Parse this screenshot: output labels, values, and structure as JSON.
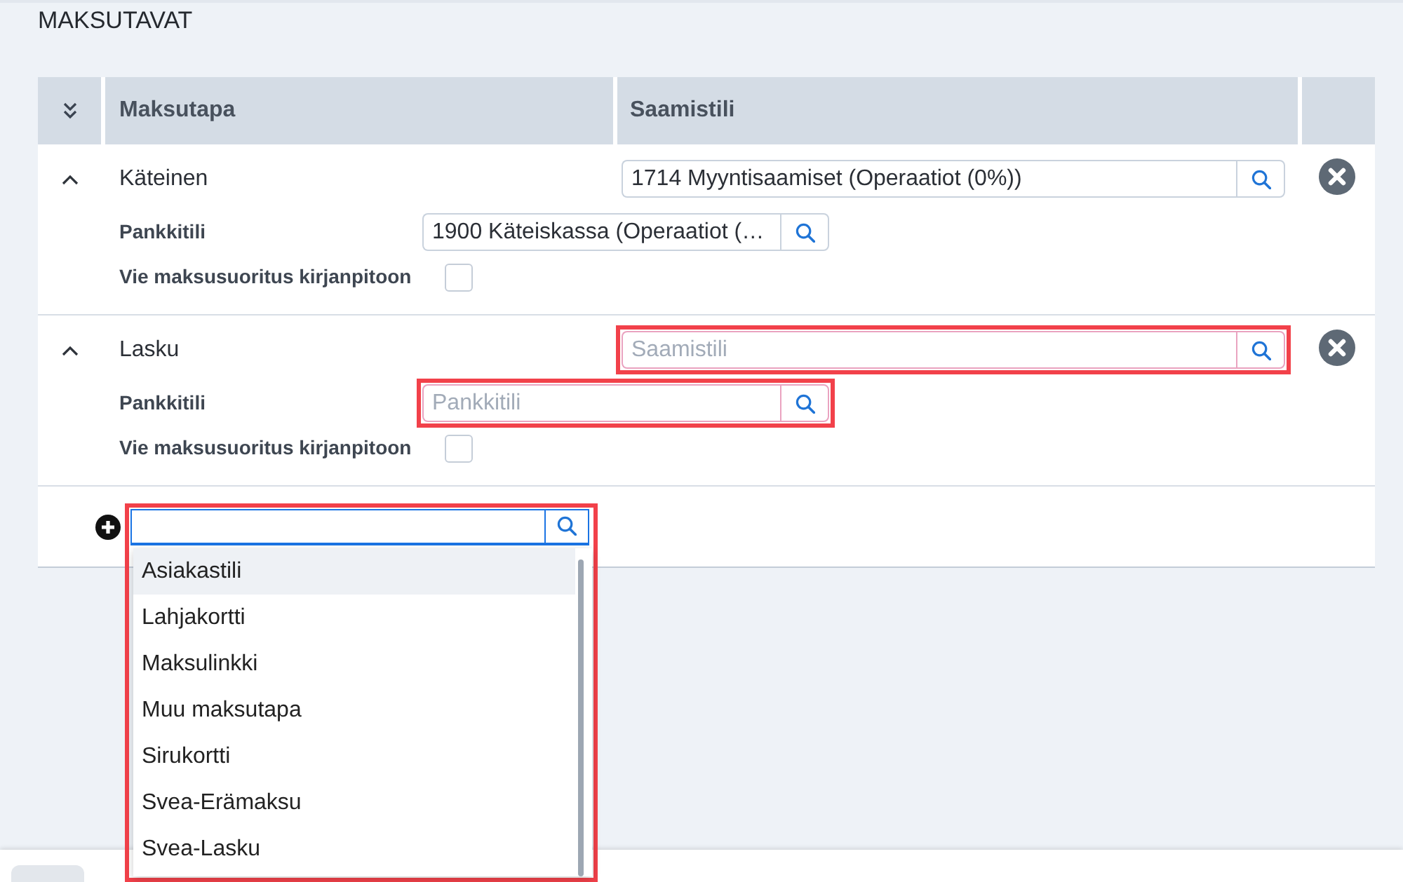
{
  "section_title": "MAKSUTAVAT",
  "table": {
    "columns": [
      "Maksutapa",
      "Saamistili"
    ],
    "rows": [
      {
        "name": "Käteinen",
        "expanded": true,
        "saamistili": {
          "value": "1714 Myyntisaamiset (Operaatiot (0%))",
          "invalid": false,
          "highlighted": false
        },
        "pankkitili_label": "Pankkitili",
        "pankkitili": {
          "value": "1900 Käteiskassa (Operaatiot (…",
          "invalid": false,
          "highlighted": false
        },
        "export_label": "Vie maksusuoritus kirjanpitoon",
        "export_checked": false
      },
      {
        "name": "Lasku",
        "expanded": true,
        "saamistili": {
          "placeholder": "Saamistili",
          "invalid": true,
          "highlighted": true
        },
        "pankkitili_label": "Pankkitili",
        "pankkitili": {
          "placeholder": "Pankkitili",
          "invalid": true,
          "highlighted": true
        },
        "export_label": "Vie maksusuoritus kirjanpitoon",
        "export_checked": false
      }
    ],
    "add_row": {
      "focused": true,
      "highlighted": true,
      "options": [
        {
          "label": "Asiakastili",
          "selected": true
        },
        {
          "label": "Lahjakortti",
          "selected": false
        },
        {
          "label": "Maksulinkki",
          "selected": false
        },
        {
          "label": "Muu maksutapa",
          "selected": false
        },
        {
          "label": "Sirukortti",
          "selected": false
        },
        {
          "label": "Svea-Erämaksu",
          "selected": false
        },
        {
          "label": "Svea-Lasku",
          "selected": false
        }
      ]
    }
  }
}
